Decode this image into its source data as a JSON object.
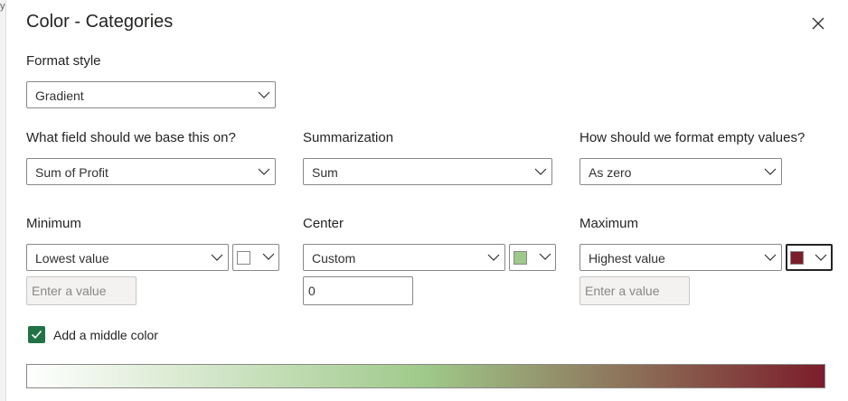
{
  "edge_glyph": "y",
  "dialog": {
    "title": "Color - Categories",
    "close_icon": "close-icon"
  },
  "format_style": {
    "label": "Format style",
    "value": "Gradient"
  },
  "base_field": {
    "label": "What field should we base this on?",
    "value": "Sum of Profit"
  },
  "summarization": {
    "label": "Summarization",
    "value": "Sum"
  },
  "empty_values": {
    "label": "How should we format empty values?",
    "value": "As zero"
  },
  "minimum": {
    "label": "Minimum",
    "type_value": "Lowest value",
    "color": "#ffffff",
    "input_placeholder": "Enter a value",
    "input_value": ""
  },
  "center": {
    "label": "Center",
    "type_value": "Custom",
    "color": "#9fc98a",
    "input_placeholder": "",
    "input_value": "0"
  },
  "maximum": {
    "label": "Maximum",
    "type_value": "Highest value",
    "color": "#7b1d2a",
    "input_placeholder": "Enter a value",
    "input_value": ""
  },
  "middle_color": {
    "label": "Add a middle color",
    "checked": true
  },
  "gradient": {
    "colors": [
      "#ffffff",
      "#9fc98a",
      "#7b1d2a"
    ]
  }
}
